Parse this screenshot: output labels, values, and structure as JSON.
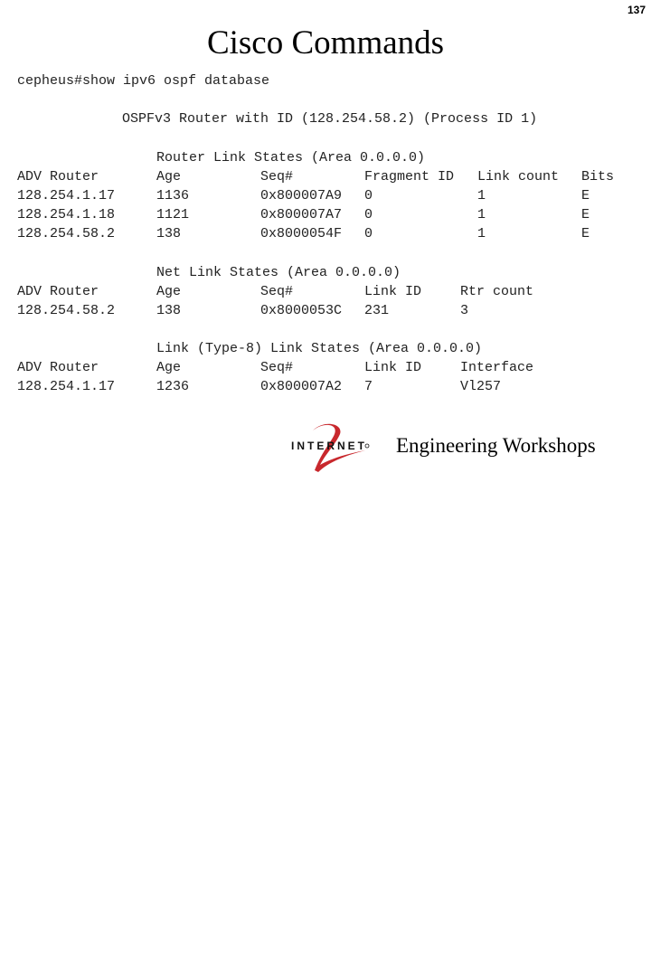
{
  "page_number": "137",
  "title": "Cisco Commands",
  "command": "cepheus#show ipv6 ospf database",
  "router_header": "OSPFv3 Router with ID (128.254.58.2) (Process ID 1)",
  "router_link_states": {
    "heading": "Router Link States (Area 0.0.0.0)",
    "columns": [
      "ADV Router",
      "Age",
      "Seq#",
      "Fragment ID",
      "Link count",
      "Bits"
    ],
    "rows": [
      [
        "128.254.1.17",
        "1136",
        "0x800007A9",
        "0",
        "1",
        "E"
      ],
      [
        "128.254.1.18",
        "1121",
        "0x800007A7",
        "0",
        "1",
        "E"
      ],
      [
        "128.254.58.2",
        "138",
        "0x8000054F",
        "0",
        "1",
        "E"
      ]
    ]
  },
  "net_link_states": {
    "heading": "Net Link States (Area 0.0.0.0)",
    "columns": [
      "ADV Router",
      "Age",
      "Seq#",
      "Link ID",
      "Rtr count"
    ],
    "rows": [
      [
        "128.254.58.2",
        "138",
        "0x8000053C",
        "231",
        "3"
      ]
    ]
  },
  "link_type8_states": {
    "heading": "Link (Type-8) Link States (Area 0.0.0.0)",
    "columns": [
      "ADV Router",
      "Age",
      "Seq#",
      "Link ID",
      "Interface"
    ],
    "rows": [
      [
        "128.254.1.17",
        "1236",
        "0x800007A2",
        "7",
        "Vl257"
      ]
    ]
  },
  "footer": {
    "logo_text": "INTERNET",
    "logo_icon": "internet2-logo",
    "logo_color": "#c8282d",
    "text": "Engineering Workshops"
  }
}
